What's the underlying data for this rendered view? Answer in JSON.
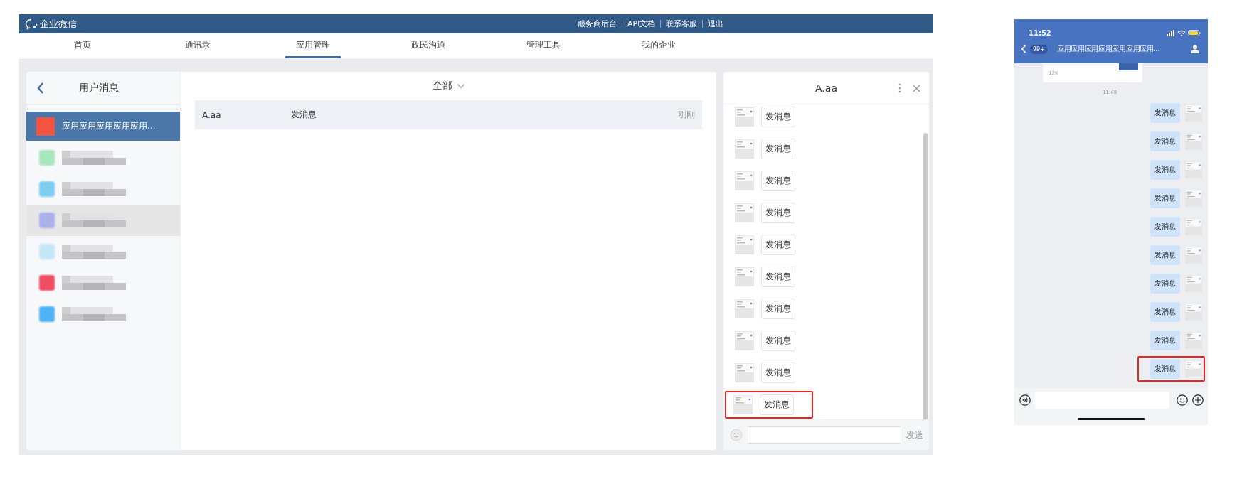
{
  "top_bar": {
    "logo": "企业微信",
    "links": [
      "服务商后台",
      "API文档",
      "联系客服",
      "退出"
    ]
  },
  "nav": [
    {
      "label": "首页",
      "selected": false
    },
    {
      "label": "通讯录",
      "selected": false
    },
    {
      "label": "应用管理",
      "selected": true
    },
    {
      "label": "政民沟通",
      "selected": false
    },
    {
      "label": "管理工具",
      "selected": false
    },
    {
      "label": "我的企业",
      "selected": false
    }
  ],
  "sidebar": {
    "title": "用户消息",
    "items": [
      {
        "kind": "app",
        "name": "应用应用应用应用应用...",
        "color": "#f25440",
        "selected": true,
        "hovered": false
      },
      {
        "kind": "redacted",
        "color": "#a8e6bc",
        "selected": false,
        "hovered": false
      },
      {
        "kind": "redacted",
        "color": "#7fcdf2",
        "selected": false,
        "hovered": false
      },
      {
        "kind": "redacted",
        "color": "#aab0ec",
        "selected": false,
        "hovered": true
      },
      {
        "kind": "redacted",
        "color": "#c6e6f8",
        "selected": false,
        "hovered": false
      },
      {
        "kind": "redacted",
        "color": "#ee4d62",
        "selected": false,
        "hovered": false
      },
      {
        "kind": "redacted",
        "color": "#4fb4f4",
        "selected": false,
        "hovered": false
      }
    ]
  },
  "filter": {
    "label": "全部"
  },
  "messages": [
    {
      "sender": "A.aa",
      "text": "发消息",
      "time": "刚刚"
    }
  ],
  "chat": {
    "title": "A.aa",
    "send_label": "发送",
    "messages": [
      {
        "text": "发消息",
        "highlighted": false
      },
      {
        "text": "发消息",
        "highlighted": false
      },
      {
        "text": "发消息",
        "highlighted": false
      },
      {
        "text": "发消息",
        "highlighted": false
      },
      {
        "text": "发消息",
        "highlighted": false
      },
      {
        "text": "发消息",
        "highlighted": false
      },
      {
        "text": "发消息",
        "highlighted": false
      },
      {
        "text": "发消息",
        "highlighted": false
      },
      {
        "text": "发消息",
        "highlighted": false
      },
      {
        "text": "发消息",
        "highlighted": true
      }
    ]
  },
  "phone": {
    "time": "11:52",
    "badge": "99+",
    "title": "应用应用应用应用应用应用应用...",
    "file_size": "12K",
    "timestamp": "11:49",
    "messages": [
      {
        "text": "发消息",
        "highlighted": false
      },
      {
        "text": "发消息",
        "highlighted": false
      },
      {
        "text": "发消息",
        "highlighted": false
      },
      {
        "text": "发消息",
        "highlighted": false
      },
      {
        "text": "发消息",
        "highlighted": false
      },
      {
        "text": "发消息",
        "highlighted": false
      },
      {
        "text": "发消息",
        "highlighted": false
      },
      {
        "text": "发消息",
        "highlighted": false
      },
      {
        "text": "发消息",
        "highlighted": false
      },
      {
        "text": "发消息",
        "highlighted": true
      }
    ]
  }
}
